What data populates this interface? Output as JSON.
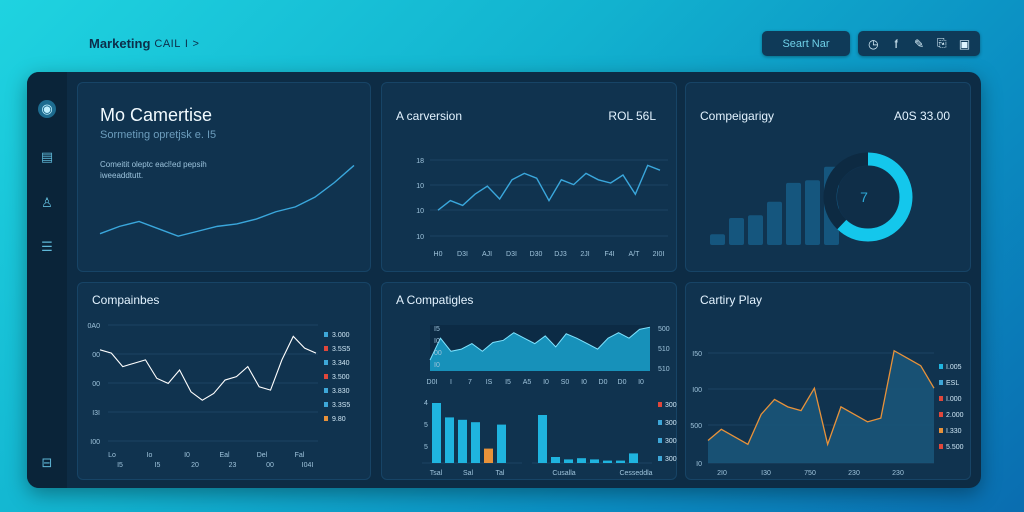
{
  "header": {
    "brand": "Marketing",
    "brand_sub": "CAIL",
    "brand_sep": "I",
    "brand_arrow": ">",
    "search_label": "Seart Nar",
    "toolbar_icons": [
      "clock-icon",
      "facebook-icon",
      "pen-icon",
      "tag-icon",
      "bag-icon"
    ],
    "toolbar_glyphs": [
      "◷",
      "f",
      "✎",
      "⎘",
      "▣"
    ]
  },
  "rail": {
    "icons": [
      "dashboard-icon",
      "document-icon",
      "user-icon",
      "list-icon",
      "settings-icon"
    ],
    "glyphs": [
      "◉",
      "▤",
      "♙",
      "☰",
      "⊟"
    ]
  },
  "cards": {
    "hero": {
      "title": "Mo Camertise",
      "subtitle": "Sormeting opretjsk e. I5",
      "note": "Comeitit oleptc eacl!ed pepsih iweeaddtutt.",
      "line": [
        3,
        6,
        8,
        5,
        2,
        4,
        6,
        7,
        9,
        12,
        14,
        18,
        24,
        31
      ]
    },
    "conversion": {
      "title": "A carversion",
      "value": "ROL 56L",
      "y_ticks": [
        "18",
        "10",
        "10",
        "10"
      ],
      "x_ticks": [
        "H0",
        "D3I",
        "AJI",
        "D3I",
        "D30",
        "DJ3",
        "2JI",
        "F4I",
        "A/T",
        "2I0I"
      ],
      "line": [
        8,
        14,
        11,
        18,
        23,
        15,
        27,
        31,
        28,
        14,
        27,
        24,
        31,
        27,
        25,
        30,
        18,
        36,
        33
      ]
    },
    "campaign": {
      "title": "Compeigarigy",
      "value": "A0S 33.00",
      "bars": [
        8,
        20,
        22,
        32,
        46,
        48,
        58
      ],
      "donut_label": "7",
      "donut_fraction": 0.62
    },
    "companies": {
      "title": "Compainbes",
      "y_ticks": [
        "0A0",
        "00",
        "00",
        "I3I",
        "I00"
      ],
      "x_ticks": [
        "Lo",
        "Io",
        "I0",
        "Eal",
        "Del",
        "Fal"
      ],
      "x_sub": [
        "I5",
        "I5",
        "20",
        "23",
        "00",
        "I04I"
      ],
      "line": [
        40,
        38,
        30,
        32,
        34,
        23,
        20,
        28,
        15,
        10,
        14,
        22,
        24,
        30,
        18,
        16,
        34,
        48,
        41,
        38
      ],
      "legend": [
        {
          "color": "#3ea7d8",
          "value": "3.000"
        },
        {
          "color": "#e0473b",
          "value": "3.5S5"
        },
        {
          "color": "#3ea7d8",
          "value": "3.340"
        },
        {
          "color": "#e0473b",
          "value": "3.500"
        },
        {
          "color": "#3ea7d8",
          "value": "3.830"
        },
        {
          "color": "#3ea7d8",
          "value": "3.3S5"
        },
        {
          "color": "#e8923a",
          "value": "9.80"
        }
      ]
    },
    "campaigns2": {
      "title": "A Compatigles",
      "top_area": [
        10,
        30,
        18,
        20,
        25,
        18,
        26,
        28,
        35,
        30,
        25,
        32,
        22,
        34,
        30,
        25,
        20,
        30,
        35,
        30,
        38,
        40
      ],
      "top_y": [
        "I5",
        "I0",
        "00",
        "I0"
      ],
      "top_x": [
        "D0I",
        "I",
        "7",
        "IS",
        "I5",
        "A5",
        "I0",
        "S0",
        "I0",
        "D0",
        "D0",
        "I0"
      ],
      "top_right": [
        "500",
        "510",
        "510"
      ],
      "bars_a": [
        50,
        38,
        36,
        34,
        12,
        32
      ],
      "bars_a_colors": [
        "#1fb4df",
        "#1fb4df",
        "#1fb4df",
        "#1fb4df",
        "#e8923a",
        "#1fb4df"
      ],
      "bars_a_y": [
        "4",
        "5",
        "5"
      ],
      "bars_a_x": [
        "Tsal",
        "Sal",
        "Tal"
      ],
      "bars_b": [
        40,
        5,
        3,
        4,
        3,
        2,
        2,
        8
      ],
      "bars_b_x": [
        "Cusalla",
        "Cesseddla"
      ],
      "legend": [
        {
          "color": "#e0473b",
          "value": "300"
        },
        {
          "color": "#3ea7d8",
          "value": "300"
        },
        {
          "color": "#3ea7d8",
          "value": "300"
        },
        {
          "color": "#3ea7d8",
          "value": "300"
        }
      ]
    },
    "cartiry": {
      "title": "Cartiry Play",
      "y_ticks": [
        "I50",
        "I00",
        "500",
        "I0"
      ],
      "x_ticks": [
        "2I0",
        "I30",
        "750",
        "230",
        "230"
      ],
      "area": [
        12,
        18,
        14,
        10,
        26,
        34,
        30,
        28,
        40,
        10,
        30,
        26,
        22,
        24,
        60,
        56,
        52,
        40
      ],
      "legend": [
        {
          "color": "#1fb4df",
          "value": "I.005"
        },
        {
          "color": "#3ea7d8",
          "value": "ESL"
        },
        {
          "color": "#e0473b",
          "value": "I.000"
        },
        {
          "color": "#e0473b",
          "value": "2.000"
        },
        {
          "color": "#e8923a",
          "value": "I.330"
        },
        {
          "color": "#e0473b",
          "value": "5.500"
        }
      ]
    }
  }
}
